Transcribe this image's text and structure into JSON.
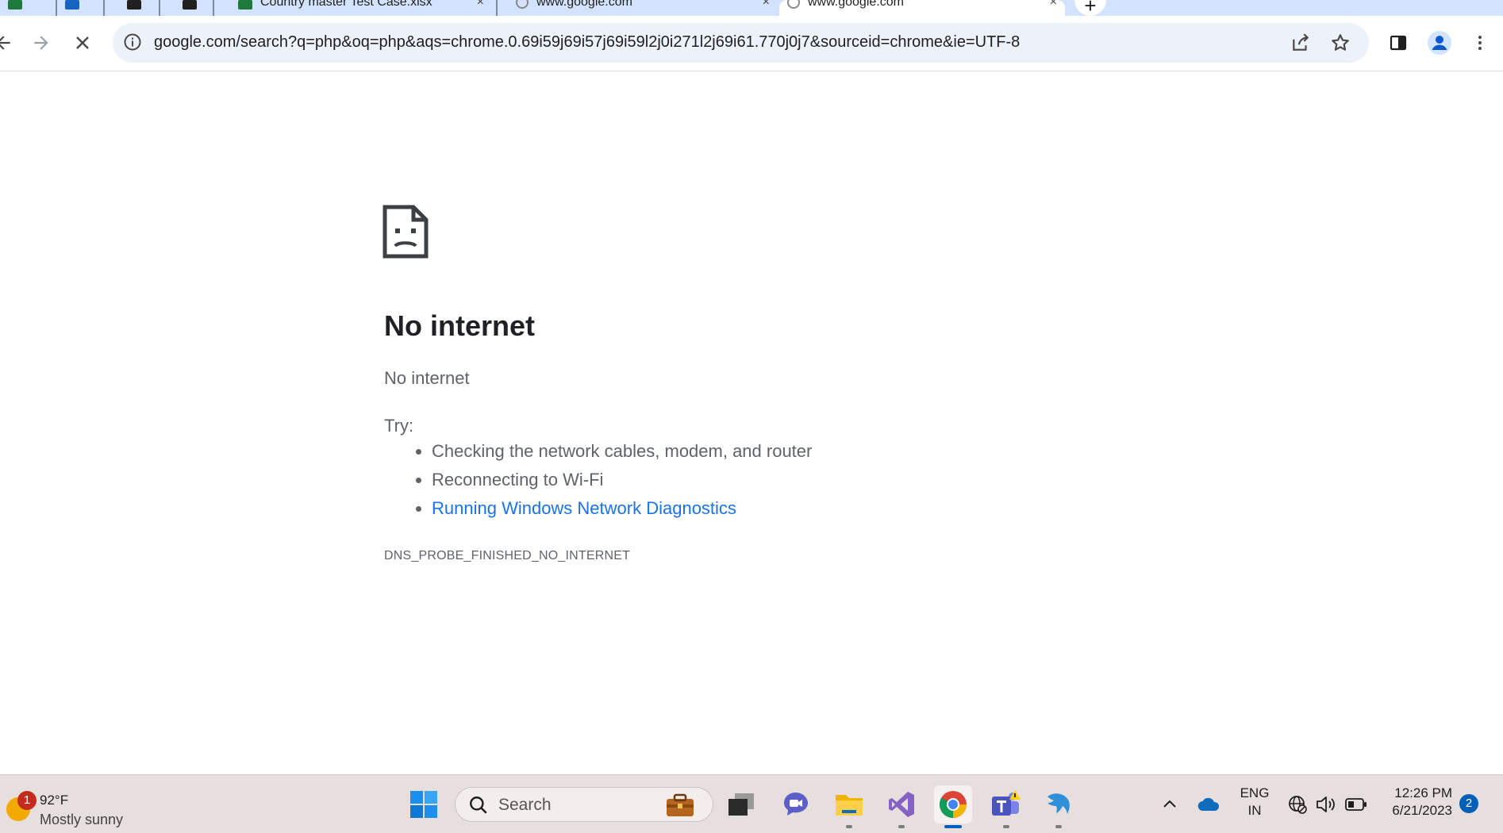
{
  "browser": {
    "tabs": [
      {
        "title": "",
        "favicon": "excel-icon"
      },
      {
        "title": "",
        "favicon": "outlook-icon"
      },
      {
        "title": "",
        "favicon": "app-icon"
      },
      {
        "title": "",
        "favicon": "app-icon"
      },
      {
        "title": "Country master Test Case.xlsx",
        "favicon": "excel-icon"
      },
      {
        "title": "www.google.com",
        "favicon": "globe-icon"
      },
      {
        "title": "www.google.com",
        "favicon": "loading-icon",
        "active": true
      }
    ],
    "new_tab_label": "+",
    "url": "google.com/search?q=php&oq=php&aqs=chrome.0.69i59j69i57j69i59l2j0i271l2j69i61.770j0j7&sourceid=chrome&ie=UTF-8"
  },
  "error_page": {
    "title": "No internet",
    "subtitle": "No internet",
    "try_label": "Try:",
    "suggestions": [
      "Checking the network cables, modem, and router",
      "Reconnecting to Wi-Fi"
    ],
    "diagnostics_link": "Running Windows Network Diagnostics",
    "error_code": "DNS_PROBE_FINISHED_NO_INTERNET"
  },
  "taskbar": {
    "weather": {
      "temp": "92°F",
      "desc": "Mostly sunny",
      "badge": "1"
    },
    "search_placeholder": "Search",
    "language": {
      "line1": "ENG",
      "line2": "IN"
    },
    "time": "12:26 PM",
    "date": "6/21/2023",
    "notification_count": "2"
  },
  "colors": {
    "tabstrip": "#d3e3fd",
    "omnibox": "#edf2fa",
    "link": "#1a73e8",
    "taskbar": "#e6dfdd",
    "accent": "#005fb8"
  }
}
